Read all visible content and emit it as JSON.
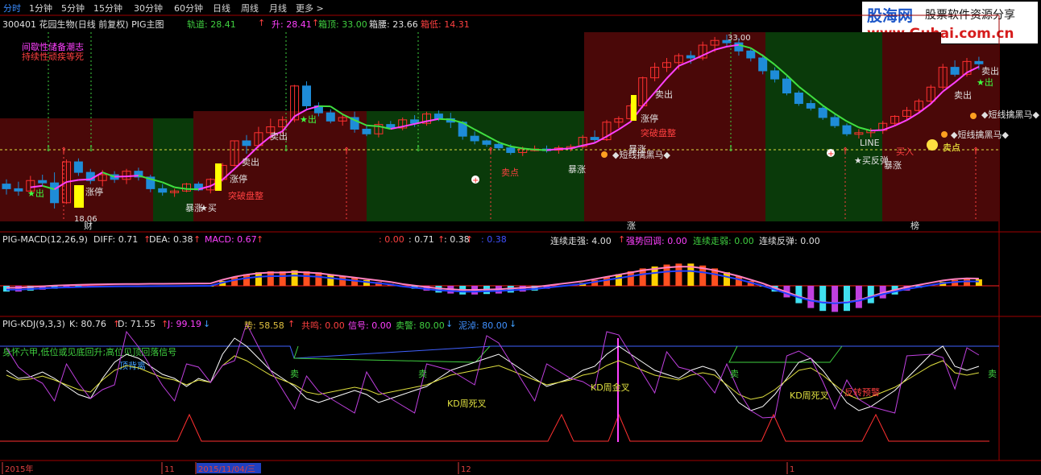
{
  "toolbar": {
    "tabs": [
      {
        "label": "分时",
        "active": true
      },
      {
        "label": "1分钟",
        "active": false
      },
      {
        "label": "5分钟",
        "active": false
      },
      {
        "label": "15分钟",
        "active": false
      },
      {
        "label": "30分钟",
        "active": false
      },
      {
        "label": "60分钟",
        "active": false
      },
      {
        "label": "日线",
        "active": false
      },
      {
        "label": "周线",
        "active": false
      },
      {
        "label": "月线",
        "active": false
      },
      {
        "label": "更多 >",
        "active": false
      }
    ]
  },
  "watermark": {
    "brand": "股海网",
    "slogan": "股票软件资源分享",
    "url": "www.Guhai.com.cn"
  },
  "main_panel": {
    "title": "300401 花园生物(日线 前复权) PIG主图",
    "stats": [
      {
        "label": "轨道: 28.41",
        "color": "#40d040"
      },
      {
        "label": "↑",
        "color": "#ff4040"
      },
      {
        "label": "升: 28.41",
        "color": "#ff40ff"
      },
      {
        "label": "↑",
        "color": "#ff4040"
      },
      {
        "label": "箱顶: 33.00",
        "color": "#40d040"
      },
      {
        "label": "箱腰: 23.66",
        "color": "#e0e0e0"
      },
      {
        "label": "箱低: 14.31",
        "color": "#ff4040"
      }
    ],
    "notes": [
      "间歇性储备潮志",
      "持续性顽疾等死"
    ],
    "high_label": "33.00",
    "low_label": "18.06",
    "markers": {
      "buy": "买",
      "sell": "卖出",
      "zhangting": "涨停",
      "tupo": "突破盘整",
      "baozhang": "暴涨",
      "star_out": "★出",
      "star_buy": "★买",
      "line": "LINE",
      "dark_horse": "◆短线擒黑马◆",
      "fan_tan": "★买反弹",
      "buy_in": "买入",
      "cai": "财",
      "zhang": "涨",
      "bang": "榜",
      "sell_dot": "卖点"
    }
  },
  "macd_panel": {
    "name": "PIG-MACD(12,26,9)",
    "stats": [
      {
        "label": "DIFF: 0.71",
        "color": "#e0e0e0"
      },
      {
        "label": "↑",
        "color": "#ff4040"
      },
      {
        "label": "DEA: 0.38",
        "color": "#e0e0e0"
      },
      {
        "label": "↑",
        "color": "#ff4040"
      },
      {
        "label": "MACD: 0.67",
        "color": "#ff40ff"
      },
      {
        "label": "↑",
        "color": "#ff4040"
      },
      {
        "label": ": 0.00",
        "color": "#ff4040"
      },
      {
        "label": ": 0.71",
        "color": "#e0e0e0"
      },
      {
        "label": "↑",
        "color": "#ff4040"
      },
      {
        "label": ": 0.38",
        "color": "#e0e0e0"
      },
      {
        "label": "↑",
        "color": "#ff4040"
      },
      {
        "label": ": 0.38",
        "color": "#4050ff"
      },
      {
        "label": "连续走强: 4.00",
        "color": "#e0e0e0"
      },
      {
        "label": "↑",
        "color": "#ff4040"
      },
      {
        "label": "强势回调: 0.00",
        "color": "#ff40ff"
      },
      {
        "label": "连续走弱: 0.00",
        "color": "#40d040"
      },
      {
        "label": "连续反弹: 0.00",
        "color": "#e0e0e0"
      }
    ]
  },
  "kdj_panel": {
    "name": "PIG-KDJ(9,3,3)",
    "stats": [
      {
        "label": "K: 80.76",
        "color": "#e0e0e0"
      },
      {
        "label": "↑",
        "color": "#ff4040"
      },
      {
        "label": "D: 71.55",
        "color": "#e0e0e0"
      },
      {
        "label": "↑",
        "color": "#ff4040"
      },
      {
        "label": "J: 99.19",
        "color": "#ff40ff"
      },
      {
        "label": "↓",
        "color": "#40a0ff"
      },
      {
        "label": "势: 58.58",
        "color": "#e0c040"
      },
      {
        "label": "↑",
        "color": "#ff4040"
      },
      {
        "label": "共鸣: 0.00",
        "color": "#ff4040"
      },
      {
        "label": "信号: 0.00",
        "color": "#ff40ff"
      },
      {
        "label": "卖警: 80.00",
        "color": "#40d040"
      },
      {
        "label": "↓",
        "color": "#40a0ff"
      },
      {
        "label": "泥淖: 80.00",
        "color": "#4090ff"
      },
      {
        "label": "↓",
        "color": "#40a0ff"
      }
    ],
    "notes": [
      "身怀六甲,低位或见底回升;高位见顶回落信号",
      "顶背离"
    ],
    "signals": {
      "sell": "卖",
      "kd_dead": "KD周死叉",
      "kd_gold": "KD周金叉",
      "reverse": "反转预警"
    }
  },
  "time_axis": {
    "labels": [
      "2015年",
      "11",
      "2015/11/04/三",
      "12",
      "1"
    ]
  },
  "colors": {
    "bg": "#000000",
    "up_zone": "#4a0808",
    "down_zone": "#0a3a0a",
    "up_candle": "#ff3030",
    "down_candle": "#1e8cd8",
    "ma_up": "#ff40ff",
    "ma_down": "#40e040",
    "yellow": "#ffff00"
  },
  "chart_data": {
    "type": "candlestick",
    "x": "daily bars, 2015-10 to 2016-01 (approx. 80 bars)",
    "candles": [
      [
        20.2,
        20.6,
        19.3,
        19.8
      ],
      [
        19.8,
        20.4,
        19.2,
        19.6
      ],
      [
        19.6,
        20.9,
        19.4,
        20.5
      ],
      [
        20.5,
        21.0,
        20.0,
        20.3
      ],
      [
        20.3,
        21.2,
        18.1,
        18.6
      ],
      [
        18.6,
        22.3,
        18.5,
        22.1
      ],
      [
        22.1,
        22.4,
        20.9,
        21.2
      ],
      [
        21.2,
        21.5,
        20.2,
        20.5
      ],
      [
        20.5,
        21.4,
        20.0,
        21.0
      ],
      [
        21.0,
        21.3,
        20.3,
        20.6
      ],
      [
        20.6,
        21.5,
        20.2,
        21.3
      ],
      [
        21.3,
        21.6,
        20.5,
        20.8
      ],
      [
        20.8,
        21.0,
        19.5,
        19.8
      ],
      [
        19.8,
        20.2,
        19.2,
        19.5
      ],
      [
        19.5,
        19.8,
        19.1,
        19.6
      ],
      [
        19.6,
        20.3,
        19.5,
        20.2
      ],
      [
        20.2,
        20.4,
        19.6,
        19.7
      ],
      [
        19.7,
        20.7,
        19.4,
        20.6
      ],
      [
        20.6,
        22.0,
        20.4,
        21.8
      ],
      [
        21.8,
        23.9,
        21.7,
        23.9
      ],
      [
        23.9,
        24.4,
        22.8,
        23.5
      ],
      [
        23.5,
        25.1,
        23.3,
        24.6
      ],
      [
        24.6,
        25.8,
        24.0,
        25.1
      ],
      [
        25.1,
        26.0,
        24.5,
        25.7
      ],
      [
        25.7,
        28.7,
        25.5,
        28.6
      ],
      [
        28.6,
        29.0,
        26.5,
        26.9
      ],
      [
        26.9,
        27.2,
        26.0,
        26.3
      ],
      [
        26.3,
        26.6,
        25.4,
        25.6
      ],
      [
        25.6,
        26.2,
        25.2,
        25.9
      ],
      [
        25.9,
        26.4,
        24.6,
        24.9
      ],
      [
        24.9,
        25.2,
        24.3,
        24.5
      ],
      [
        24.5,
        25.6,
        24.2,
        25.3
      ],
      [
        25.3,
        25.6,
        24.9,
        25.0
      ],
      [
        25.0,
        25.9,
        24.8,
        25.7
      ],
      [
        25.7,
        26.1,
        25.1,
        25.4
      ],
      [
        25.4,
        26.4,
        25.2,
        26.2
      ],
      [
        26.2,
        26.5,
        25.6,
        25.8
      ],
      [
        25.8,
        26.3,
        25.0,
        25.5
      ],
      [
        25.5,
        25.6,
        24.0,
        24.3
      ],
      [
        24.3,
        24.7,
        23.6,
        23.9
      ],
      [
        23.9,
        24.0,
        23.4,
        23.6
      ],
      [
        23.6,
        23.9,
        23.1,
        23.3
      ],
      [
        23.3,
        23.6,
        22.7,
        22.9
      ],
      [
        22.9,
        23.4,
        22.6,
        23.2
      ],
      [
        23.2,
        23.5,
        23.0,
        23.2
      ],
      [
        23.2,
        23.5,
        22.9,
        23.1
      ],
      [
        23.1,
        23.5,
        22.8,
        23.3
      ],
      [
        23.3,
        23.6,
        23.0,
        23.4
      ],
      [
        23.4,
        24.4,
        23.2,
        24.2
      ],
      [
        24.2,
        24.8,
        23.7,
        24.0
      ],
      [
        24.0,
        25.7,
        23.9,
        25.5
      ],
      [
        25.5,
        26.0,
        25.0,
        25.8
      ],
      [
        25.8,
        27.1,
        25.5,
        26.9
      ],
      [
        26.9,
        29.4,
        26.7,
        29.3
      ],
      [
        29.3,
        30.6,
        29.0,
        30.2
      ],
      [
        30.2,
        31.0,
        29.8,
        30.6
      ],
      [
        30.6,
        31.4,
        30.0,
        31.2
      ],
      [
        31.2,
        31.6,
        30.5,
        31.0
      ],
      [
        31.0,
        32.4,
        30.8,
        32.1
      ],
      [
        32.1,
        32.8,
        31.5,
        32.5
      ],
      [
        32.5,
        33.0,
        31.9,
        32.3
      ],
      [
        32.3,
        32.7,
        31.2,
        31.6
      ],
      [
        31.6,
        31.8,
        30.7,
        31.0
      ],
      [
        31.0,
        31.3,
        29.6,
        29.9
      ],
      [
        29.9,
        30.2,
        28.9,
        29.2
      ],
      [
        29.2,
        29.5,
        27.8,
        28.0
      ],
      [
        28.0,
        28.2,
        26.9,
        27.1
      ],
      [
        27.1,
        27.4,
        26.5,
        26.7
      ],
      [
        26.7,
        26.9,
        25.7,
        25.9
      ],
      [
        25.9,
        26.2,
        25.0,
        25.2
      ],
      [
        25.2,
        25.4,
        24.3,
        24.5
      ],
      [
        24.5,
        24.9,
        24.1,
        24.6
      ],
      [
        24.6,
        25.0,
        24.2,
        24.8
      ],
      [
        24.8,
        25.6,
        24.5,
        25.4
      ],
      [
        25.4,
        26.1,
        25.2,
        26.0
      ],
      [
        26.0,
        26.8,
        25.7,
        26.5
      ],
      [
        26.5,
        27.5,
        26.3,
        27.3
      ],
      [
        27.3,
        28.7,
        27.1,
        28.5
      ],
      [
        28.5,
        30.5,
        28.3,
        30.2
      ],
      [
        30.2,
        30.8,
        29.4,
        29.6
      ],
      [
        29.6,
        31.0,
        29.4,
        30.7
      ],
      [
        30.7,
        31.1,
        30.0,
        30.5
      ]
    ]
  }
}
